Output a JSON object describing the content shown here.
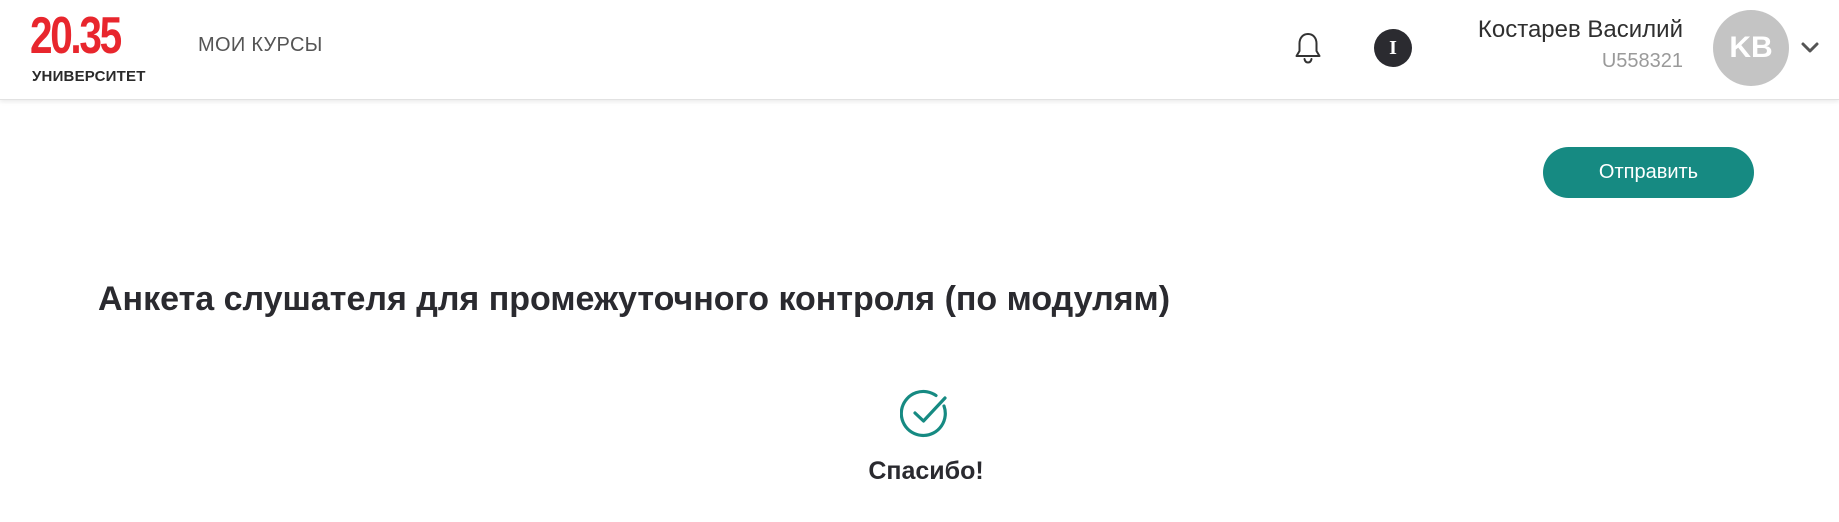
{
  "header": {
    "logo": {
      "number": "20.35",
      "subtitle": "УНИВЕРСИТЕТ",
      "color": "#e8262d"
    },
    "nav": {
      "my_courses": "МОИ КУРСЫ"
    },
    "icons": {
      "notifications": "bell-icon",
      "info": "info-icon",
      "menu": "chevron-down-icon"
    },
    "info_label": "I",
    "user": {
      "name": "Костарев Василий",
      "id": "U558321",
      "initials": "KB"
    }
  },
  "actions": {
    "submit_label": "Отправить",
    "accent_color": "#168a82"
  },
  "form": {
    "title": "Анкета слушателя для промежуточного контроля (по модулям)"
  },
  "result": {
    "icon": "check-circle-icon",
    "message": "Спасибо!"
  }
}
